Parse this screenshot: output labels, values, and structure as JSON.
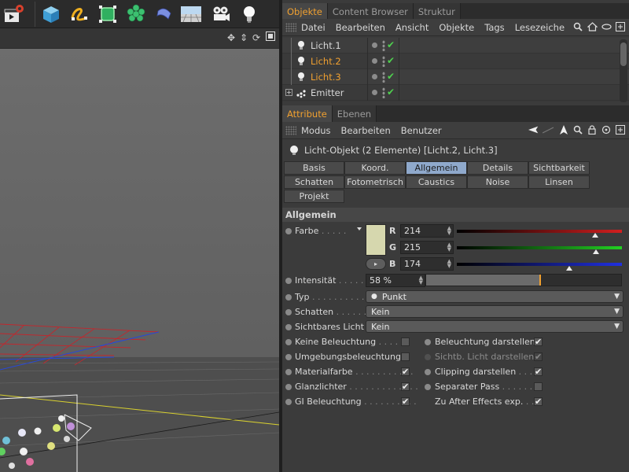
{
  "object_manager": {
    "tabs": [
      "Objekte",
      "Content Browser",
      "Struktur"
    ],
    "menu": [
      "Datei",
      "Bearbeiten",
      "Ansicht",
      "Objekte",
      "Tags",
      "Lesezeiche"
    ],
    "objects": [
      {
        "name": "Licht.1",
        "selected": false
      },
      {
        "name": "Licht.2",
        "selected": true
      },
      {
        "name": "Licht.3",
        "selected": true
      },
      {
        "name": "Emitter",
        "selected": false
      }
    ]
  },
  "attribute_manager": {
    "tabs": [
      "Attribute",
      "Ebenen"
    ],
    "menu": [
      "Modus",
      "Bearbeiten",
      "Benutzer"
    ],
    "title": "Licht-Objekt (2 Elemente) [Licht.2, Licht.3]",
    "tabs_row1": [
      "Basis",
      "Koord.",
      "Allgemein",
      "Details",
      "Sichtbarkeit"
    ],
    "tabs_row2": [
      "Schatten",
      "Fotometrisch",
      "Caustics",
      "Noise",
      "Linsen"
    ],
    "tabs_row3": [
      "Projekt"
    ],
    "active_tab": "Allgemein",
    "section": "Allgemein",
    "color": {
      "label": "Farbe",
      "label_dots": " . . . . .",
      "swatch_hex": "#d6d7ae",
      "r_label": "R",
      "g_label": "G",
      "b_label": "B",
      "r": 214,
      "g": 215,
      "b": 174
    },
    "intensity": {
      "label": "Intensität",
      "label_dots": " . . . . .",
      "value": "58 %",
      "fraction": 0.58
    },
    "typ": {
      "label": "Typ",
      "label_dots": " . . . . . . . . . . .",
      "value": "Punkt"
    },
    "schatten": {
      "label": "Schatten",
      "label_dots": " . . . . . .",
      "value": "Kein"
    },
    "sichtbares_licht": {
      "label": "Sichtbares Licht",
      "value": "Kein"
    },
    "checks_left": [
      {
        "label": "Keine Beleuchtung",
        "dots": " . . . . . .",
        "checked": false
      },
      {
        "label": "Umgebungsbeleuchtung",
        "dots": "",
        "checked": false
      },
      {
        "label": "Materialfarbe",
        "dots": " . . . . . . . . . . .",
        "checked": true
      },
      {
        "label": "Glanzlichter",
        "dots": " . . . . . . . . . . . . .",
        "checked": true
      },
      {
        "label": "GI Beleuchtung",
        "dots": " . . . . . . . . . .",
        "checked": true
      }
    ],
    "checks_right": [
      {
        "label": "Beleuchtung darstellen",
        "dots": "",
        "checked": true,
        "radio": true,
        "disabled": false
      },
      {
        "label": "Sichtb. Licht darstellen",
        "dots": "",
        "checked": true,
        "radio": false,
        "disabled": true
      },
      {
        "label": "Clipping darstellen",
        "dots": " . . . .",
        "checked": true,
        "radio": true,
        "disabled": false
      },
      {
        "label": "Separater Pass",
        "dots": " . . . . . . . .",
        "checked": false,
        "radio": true,
        "disabled": false
      },
      {
        "label": "Zu After Effects exp.",
        "dots": " . . .",
        "checked": true,
        "radio": false,
        "disabled": false
      }
    ]
  },
  "colors": {
    "accent_orange": "#f0a030",
    "active_tab_blue": "#8fa9cc",
    "check_green": "#4fd04f"
  }
}
